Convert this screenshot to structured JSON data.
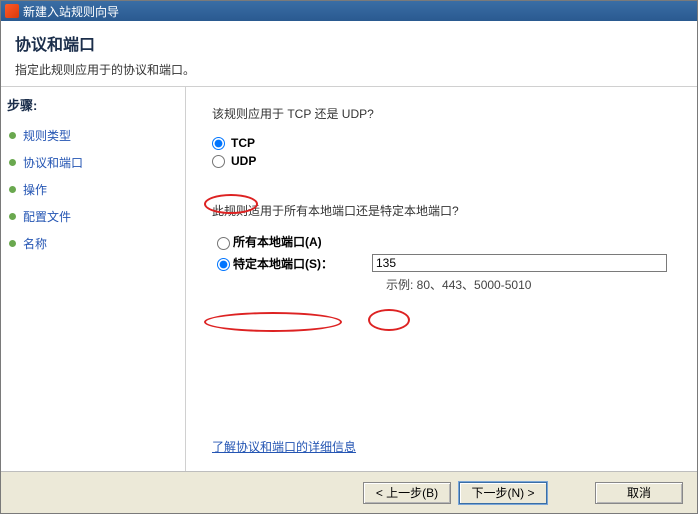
{
  "title": "新建入站规则向导",
  "header": {
    "title": "协议和端口",
    "subtitle": "指定此规则应用于的协议和端口。"
  },
  "sidebar": {
    "heading": "步骤:",
    "items": [
      {
        "label": "规则类型"
      },
      {
        "label": "协议和端口"
      },
      {
        "label": "操作"
      },
      {
        "label": "配置文件"
      },
      {
        "label": "名称"
      }
    ]
  },
  "content": {
    "protocol_question": "该规则应用于 TCP 还是 UDP?",
    "tcp_label": "TCP",
    "udp_label": "UDP",
    "port_question": "此规则适用于所有本地端口还是特定本地端口?",
    "all_ports_label": "所有本地端口(A)",
    "specific_ports_label": "特定本地端口(S)：",
    "specific_ports_value": "135",
    "example": "示例: 80、443、5000-5010",
    "learn_more": "了解协议和端口的详细信息"
  },
  "footer": {
    "back": "< 上一步(B)",
    "next": "下一步(N) >",
    "cancel": "取消"
  }
}
